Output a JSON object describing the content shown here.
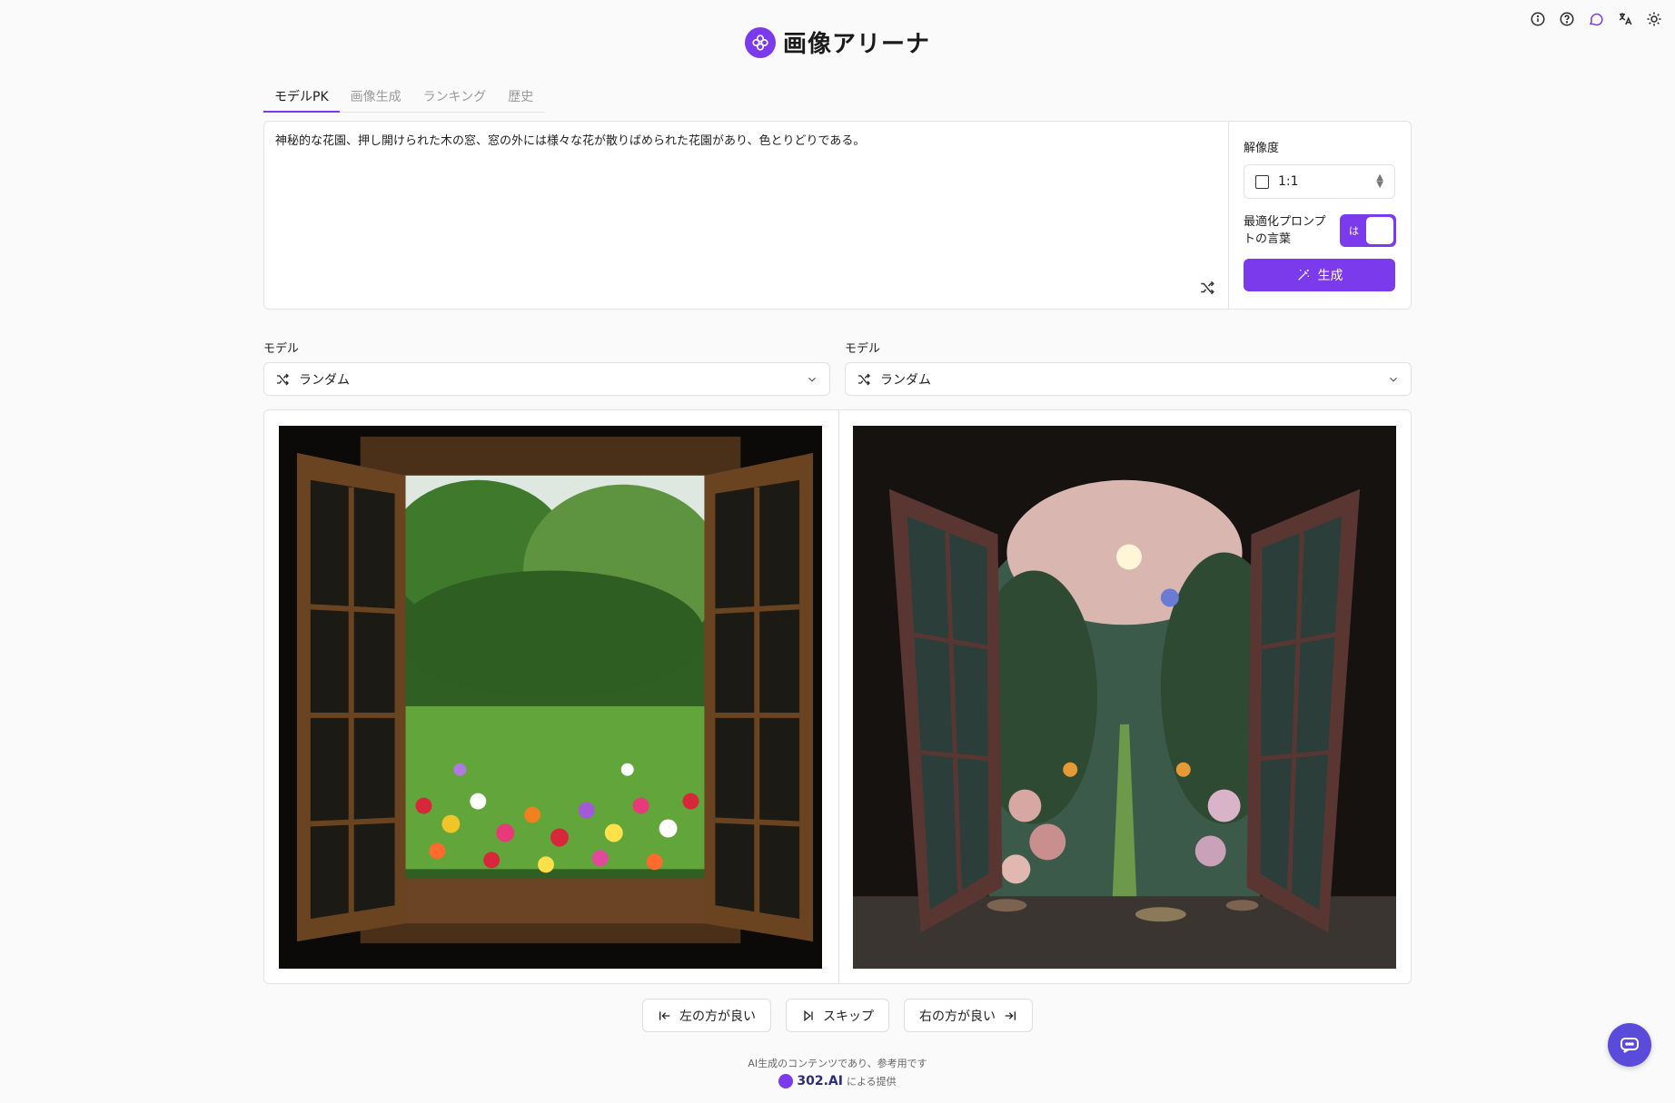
{
  "header": {
    "title": "画像アリーナ",
    "logo_icon": "flower-logo-icon",
    "accent": "#7c3aed"
  },
  "toolbar": {
    "icons": [
      "info-icon",
      "help-icon",
      "chat-icon",
      "translate-icon",
      "theme-icon"
    ]
  },
  "tabs": [
    {
      "label": "モデルPK",
      "active": true
    },
    {
      "label": "画像生成",
      "active": false
    },
    {
      "label": "ランキング",
      "active": false
    },
    {
      "label": "歴史",
      "active": false
    }
  ],
  "prompt": {
    "text": "神秘的な花園、押し開けられた木の窓、窓の外には様々な花が散りばめられた花園があり、色とりどりである。"
  },
  "settings": {
    "resolution_label": "解像度",
    "resolution_value": "1:1",
    "optimize_label": "最適化プロンプトの言葉",
    "toggle_text": "は",
    "toggle_on": true,
    "generate_label": "生成"
  },
  "models": {
    "left": {
      "label": "モデル",
      "value": "ランダム"
    },
    "right": {
      "label": "モデル",
      "value": "ランダム"
    }
  },
  "votes": {
    "left_better": "左の方が良い",
    "skip": "スキップ",
    "right_better": "右の方が良い"
  },
  "footer": {
    "disclaimer": "AI生成のコンテンツであり、参考用です",
    "brand": "302.AI",
    "provided_by": "による提供"
  }
}
